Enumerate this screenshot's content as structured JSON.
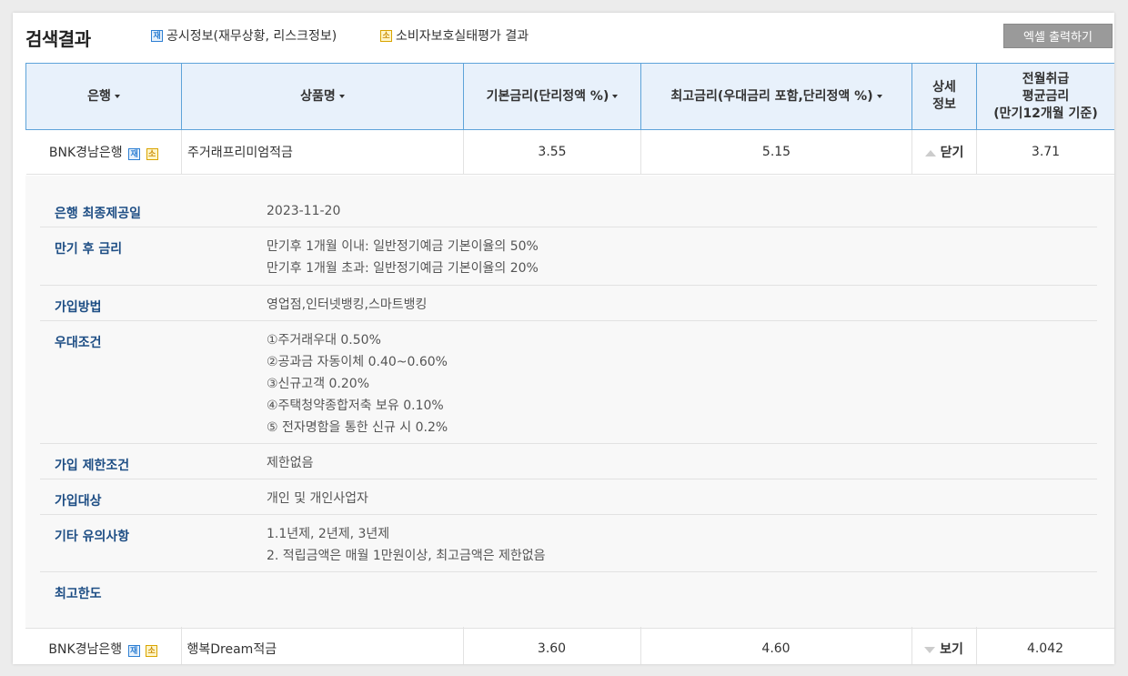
{
  "header": {
    "title": "검색결과",
    "legend_disclosure_badge": "재",
    "legend_disclosure_text": "공시정보(재무상황, 리스크정보)",
    "legend_consumer_badge": "소",
    "legend_consumer_text": "소비자보호실태평가 결과",
    "excel_button": "엑셀 출력하기"
  },
  "columns": {
    "bank": "은행",
    "product": "상품명",
    "base_rate": "기본금리(단리정액 %)",
    "max_rate": "최고금리(우대금리 포함,단리정액 %)",
    "detail_l1": "상세",
    "detail_l2": "정보",
    "avg_l1": "전월취급",
    "avg_l2": "평균금리",
    "avg_l3": "(만기12개월 기준)"
  },
  "rows": [
    {
      "bank": "BNK경남은행",
      "badge_jae": "재",
      "badge_so": "소",
      "product": "주거래프리미엄적금",
      "base_rate": "3.55",
      "max_rate": "5.15",
      "toggle": "닫기",
      "avg_rate": "3.71"
    },
    {
      "bank": "BNK경남은행",
      "badge_jae": "재",
      "badge_so": "소",
      "product": "행복Dream적금",
      "base_rate": "3.60",
      "max_rate": "4.60",
      "toggle": "보기",
      "avg_rate": "4.042"
    }
  ],
  "detail": {
    "disclosure_date_label": "은행 최종제공일",
    "disclosure_date": "2023-11-20",
    "after_maturity_label": "만기 후 금리",
    "after_maturity_1": "만기후 1개월 이내: 일반정기예금 기본이율의 50%",
    "after_maturity_2": "만기후 1개월 초과: 일반정기예금 기본이율의 20%",
    "join_method_label": "가입방법",
    "join_method": "영업점,인터넷뱅킹,스마트뱅킹",
    "preferential_label": "우대조건",
    "pref_1": "①주거래우대 0.50%",
    "pref_2": "②공과금 자동이체 0.40~0.60%",
    "pref_3": "③신규고객 0.20%",
    "pref_4": "④주택청약종합저축 보유 0.10%",
    "pref_5": "⑤ 전자명함을 통한 신규 시 0.2%",
    "restriction_label": "가입 제한조건",
    "restriction": "제한없음",
    "target_label": "가입대상",
    "target": "개인 및 개인사업자",
    "notes_label": "기타 유의사항",
    "note_1": "1.1년제, 2년제, 3년제",
    "note_2": "2. 적립금액은 매월 1만원이상, 최고금액은 제한없음",
    "max_limit_label": "최고한도"
  }
}
